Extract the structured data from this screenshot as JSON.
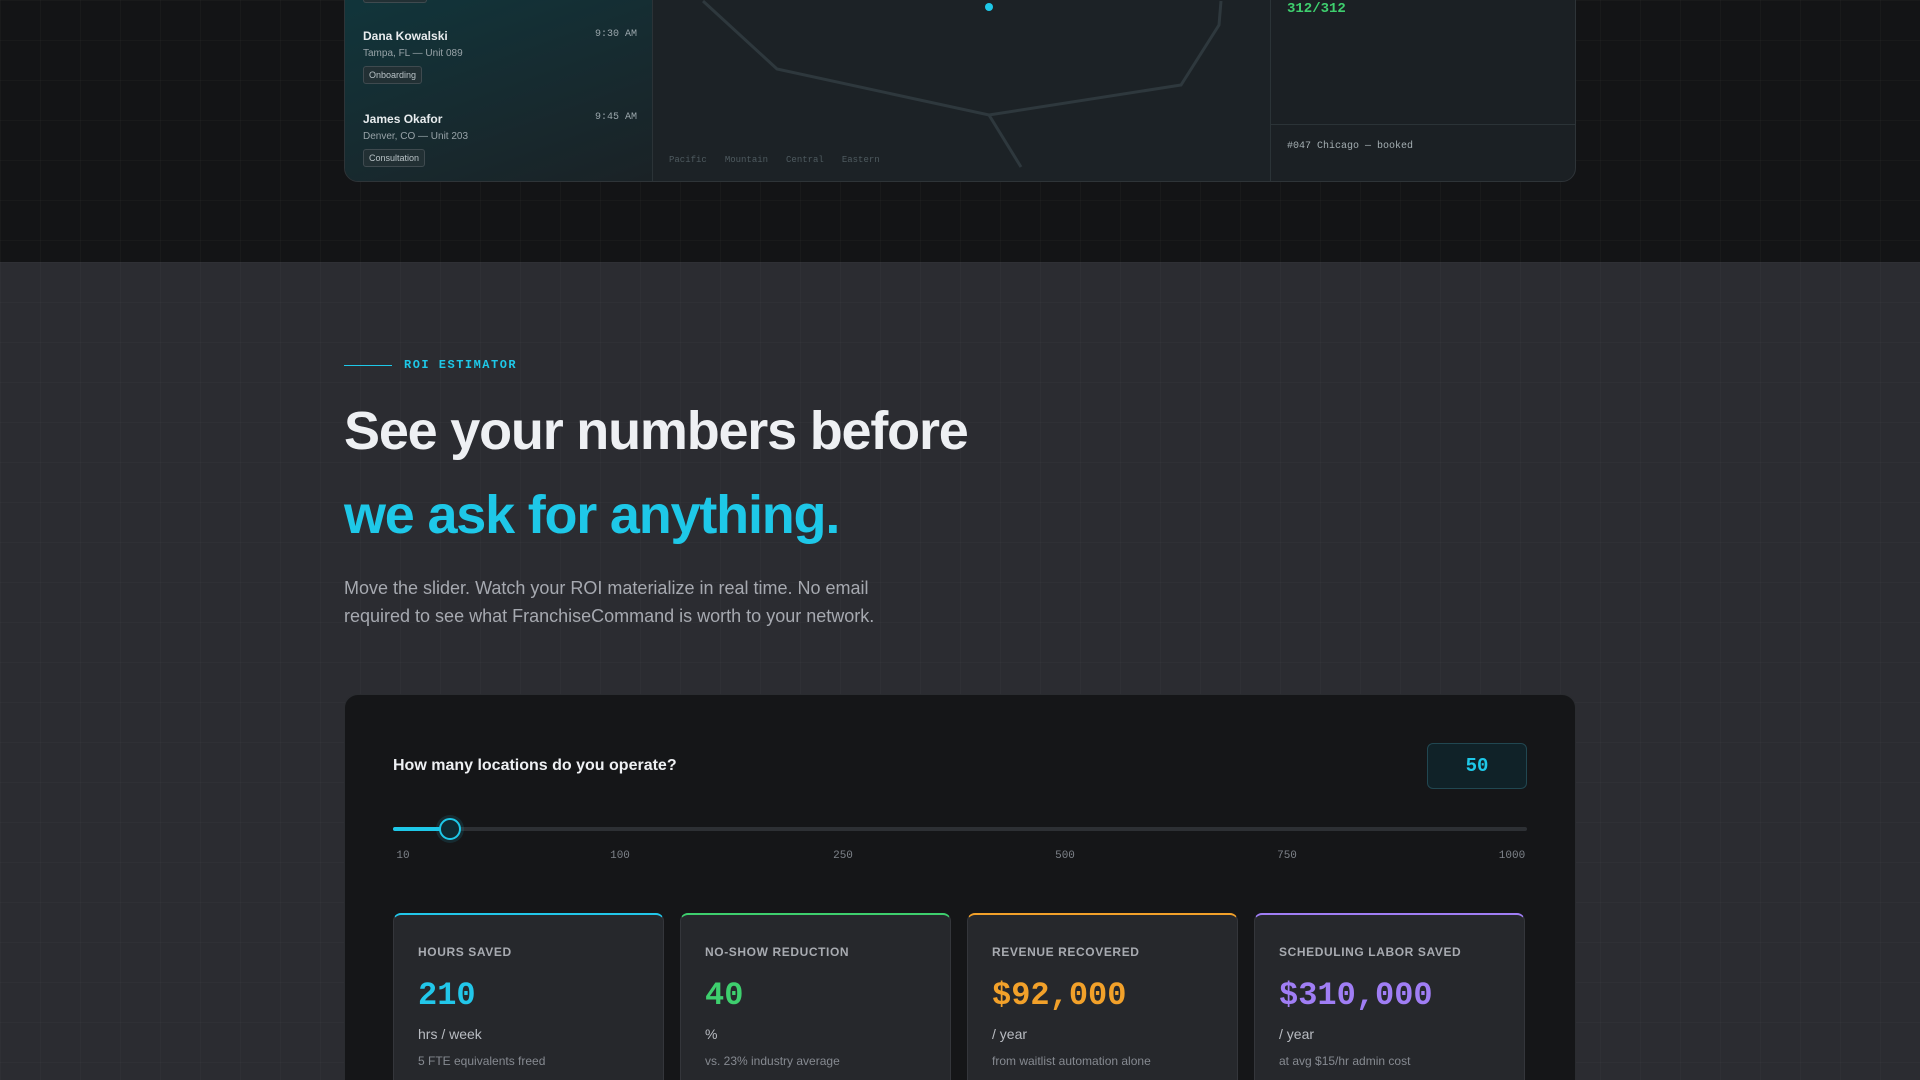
{
  "preview": {
    "appointments": [
      {
        "name": "Dana Kowalski",
        "time": "9:30 AM",
        "location": "Tampa, FL — Unit 089",
        "tag": "Onboarding"
      },
      {
        "name": "James Okafor",
        "time": "9:45 AM",
        "location": "Denver, CO — Unit 203",
        "tag": "Consultation"
      }
    ],
    "map_zones": [
      "Pacific",
      "Mountain",
      "Central",
      "Eastern"
    ],
    "booked_count": "312/312",
    "booked_event": "#047 Chicago — booked"
  },
  "roi": {
    "eyebrow": "ROI ESTIMATOR",
    "headline_line1": "See your numbers before",
    "headline_line2": "we ask for anything.",
    "lead": "Move the slider. Watch your ROI materialize in real time. No email required to see what FranchiseCommand is worth to your network.",
    "slider": {
      "question": "How many locations do you operate?",
      "value": "50",
      "value_fraction": 0.05,
      "ticks": [
        "10",
        "100",
        "250",
        "500",
        "750",
        "1000"
      ]
    },
    "metrics": [
      {
        "label": "HOURS SAVED",
        "value": "210",
        "unit": "hrs / week",
        "note": "5 FTE equivalents freed",
        "color": "#22c7ea"
      },
      {
        "label": "NO-SHOW REDUCTION",
        "value": "40",
        "unit": "%",
        "note": "vs. 23% industry average",
        "color": "#3ecf6e"
      },
      {
        "label": "REVENUE RECOVERED",
        "value": "$92,000",
        "unit": "/ year",
        "note": "from waitlist automation alone",
        "color": "#f2a12a"
      },
      {
        "label": "SCHEDULING LABOR SAVED",
        "value": "$310,000",
        "unit": "/ year",
        "note": "at avg $15/hr admin cost",
        "color": "#a07ef5"
      }
    ]
  }
}
